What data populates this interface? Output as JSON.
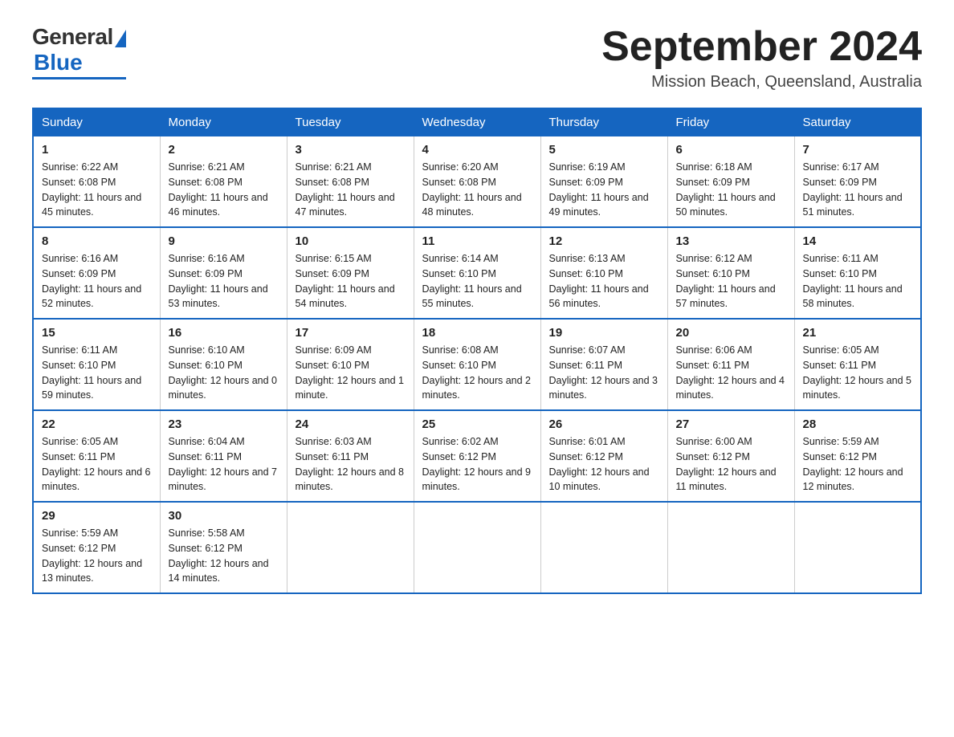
{
  "header": {
    "logo_general": "General",
    "logo_blue": "Blue",
    "month_title": "September 2024",
    "location": "Mission Beach, Queensland, Australia"
  },
  "days_of_week": [
    "Sunday",
    "Monday",
    "Tuesday",
    "Wednesday",
    "Thursday",
    "Friday",
    "Saturday"
  ],
  "weeks": [
    [
      {
        "day": "1",
        "sunrise": "Sunrise: 6:22 AM",
        "sunset": "Sunset: 6:08 PM",
        "daylight": "Daylight: 11 hours and 45 minutes."
      },
      {
        "day": "2",
        "sunrise": "Sunrise: 6:21 AM",
        "sunset": "Sunset: 6:08 PM",
        "daylight": "Daylight: 11 hours and 46 minutes."
      },
      {
        "day": "3",
        "sunrise": "Sunrise: 6:21 AM",
        "sunset": "Sunset: 6:08 PM",
        "daylight": "Daylight: 11 hours and 47 minutes."
      },
      {
        "day": "4",
        "sunrise": "Sunrise: 6:20 AM",
        "sunset": "Sunset: 6:08 PM",
        "daylight": "Daylight: 11 hours and 48 minutes."
      },
      {
        "day": "5",
        "sunrise": "Sunrise: 6:19 AM",
        "sunset": "Sunset: 6:09 PM",
        "daylight": "Daylight: 11 hours and 49 minutes."
      },
      {
        "day": "6",
        "sunrise": "Sunrise: 6:18 AM",
        "sunset": "Sunset: 6:09 PM",
        "daylight": "Daylight: 11 hours and 50 minutes."
      },
      {
        "day": "7",
        "sunrise": "Sunrise: 6:17 AM",
        "sunset": "Sunset: 6:09 PM",
        "daylight": "Daylight: 11 hours and 51 minutes."
      }
    ],
    [
      {
        "day": "8",
        "sunrise": "Sunrise: 6:16 AM",
        "sunset": "Sunset: 6:09 PM",
        "daylight": "Daylight: 11 hours and 52 minutes."
      },
      {
        "day": "9",
        "sunrise": "Sunrise: 6:16 AM",
        "sunset": "Sunset: 6:09 PM",
        "daylight": "Daylight: 11 hours and 53 minutes."
      },
      {
        "day": "10",
        "sunrise": "Sunrise: 6:15 AM",
        "sunset": "Sunset: 6:09 PM",
        "daylight": "Daylight: 11 hours and 54 minutes."
      },
      {
        "day": "11",
        "sunrise": "Sunrise: 6:14 AM",
        "sunset": "Sunset: 6:10 PM",
        "daylight": "Daylight: 11 hours and 55 minutes."
      },
      {
        "day": "12",
        "sunrise": "Sunrise: 6:13 AM",
        "sunset": "Sunset: 6:10 PM",
        "daylight": "Daylight: 11 hours and 56 minutes."
      },
      {
        "day": "13",
        "sunrise": "Sunrise: 6:12 AM",
        "sunset": "Sunset: 6:10 PM",
        "daylight": "Daylight: 11 hours and 57 minutes."
      },
      {
        "day": "14",
        "sunrise": "Sunrise: 6:11 AM",
        "sunset": "Sunset: 6:10 PM",
        "daylight": "Daylight: 11 hours and 58 minutes."
      }
    ],
    [
      {
        "day": "15",
        "sunrise": "Sunrise: 6:11 AM",
        "sunset": "Sunset: 6:10 PM",
        "daylight": "Daylight: 11 hours and 59 minutes."
      },
      {
        "day": "16",
        "sunrise": "Sunrise: 6:10 AM",
        "sunset": "Sunset: 6:10 PM",
        "daylight": "Daylight: 12 hours and 0 minutes."
      },
      {
        "day": "17",
        "sunrise": "Sunrise: 6:09 AM",
        "sunset": "Sunset: 6:10 PM",
        "daylight": "Daylight: 12 hours and 1 minute."
      },
      {
        "day": "18",
        "sunrise": "Sunrise: 6:08 AM",
        "sunset": "Sunset: 6:10 PM",
        "daylight": "Daylight: 12 hours and 2 minutes."
      },
      {
        "day": "19",
        "sunrise": "Sunrise: 6:07 AM",
        "sunset": "Sunset: 6:11 PM",
        "daylight": "Daylight: 12 hours and 3 minutes."
      },
      {
        "day": "20",
        "sunrise": "Sunrise: 6:06 AM",
        "sunset": "Sunset: 6:11 PM",
        "daylight": "Daylight: 12 hours and 4 minutes."
      },
      {
        "day": "21",
        "sunrise": "Sunrise: 6:05 AM",
        "sunset": "Sunset: 6:11 PM",
        "daylight": "Daylight: 12 hours and 5 minutes."
      }
    ],
    [
      {
        "day": "22",
        "sunrise": "Sunrise: 6:05 AM",
        "sunset": "Sunset: 6:11 PM",
        "daylight": "Daylight: 12 hours and 6 minutes."
      },
      {
        "day": "23",
        "sunrise": "Sunrise: 6:04 AM",
        "sunset": "Sunset: 6:11 PM",
        "daylight": "Daylight: 12 hours and 7 minutes."
      },
      {
        "day": "24",
        "sunrise": "Sunrise: 6:03 AM",
        "sunset": "Sunset: 6:11 PM",
        "daylight": "Daylight: 12 hours and 8 minutes."
      },
      {
        "day": "25",
        "sunrise": "Sunrise: 6:02 AM",
        "sunset": "Sunset: 6:12 PM",
        "daylight": "Daylight: 12 hours and 9 minutes."
      },
      {
        "day": "26",
        "sunrise": "Sunrise: 6:01 AM",
        "sunset": "Sunset: 6:12 PM",
        "daylight": "Daylight: 12 hours and 10 minutes."
      },
      {
        "day": "27",
        "sunrise": "Sunrise: 6:00 AM",
        "sunset": "Sunset: 6:12 PM",
        "daylight": "Daylight: 12 hours and 11 minutes."
      },
      {
        "day": "28",
        "sunrise": "Sunrise: 5:59 AM",
        "sunset": "Sunset: 6:12 PM",
        "daylight": "Daylight: 12 hours and 12 minutes."
      }
    ],
    [
      {
        "day": "29",
        "sunrise": "Sunrise: 5:59 AM",
        "sunset": "Sunset: 6:12 PM",
        "daylight": "Daylight: 12 hours and 13 minutes."
      },
      {
        "day": "30",
        "sunrise": "Sunrise: 5:58 AM",
        "sunset": "Sunset: 6:12 PM",
        "daylight": "Daylight: 12 hours and 14 minutes."
      },
      {
        "day": "",
        "sunrise": "",
        "sunset": "",
        "daylight": ""
      },
      {
        "day": "",
        "sunrise": "",
        "sunset": "",
        "daylight": ""
      },
      {
        "day": "",
        "sunrise": "",
        "sunset": "",
        "daylight": ""
      },
      {
        "day": "",
        "sunrise": "",
        "sunset": "",
        "daylight": ""
      },
      {
        "day": "",
        "sunrise": "",
        "sunset": "",
        "daylight": ""
      }
    ]
  ]
}
